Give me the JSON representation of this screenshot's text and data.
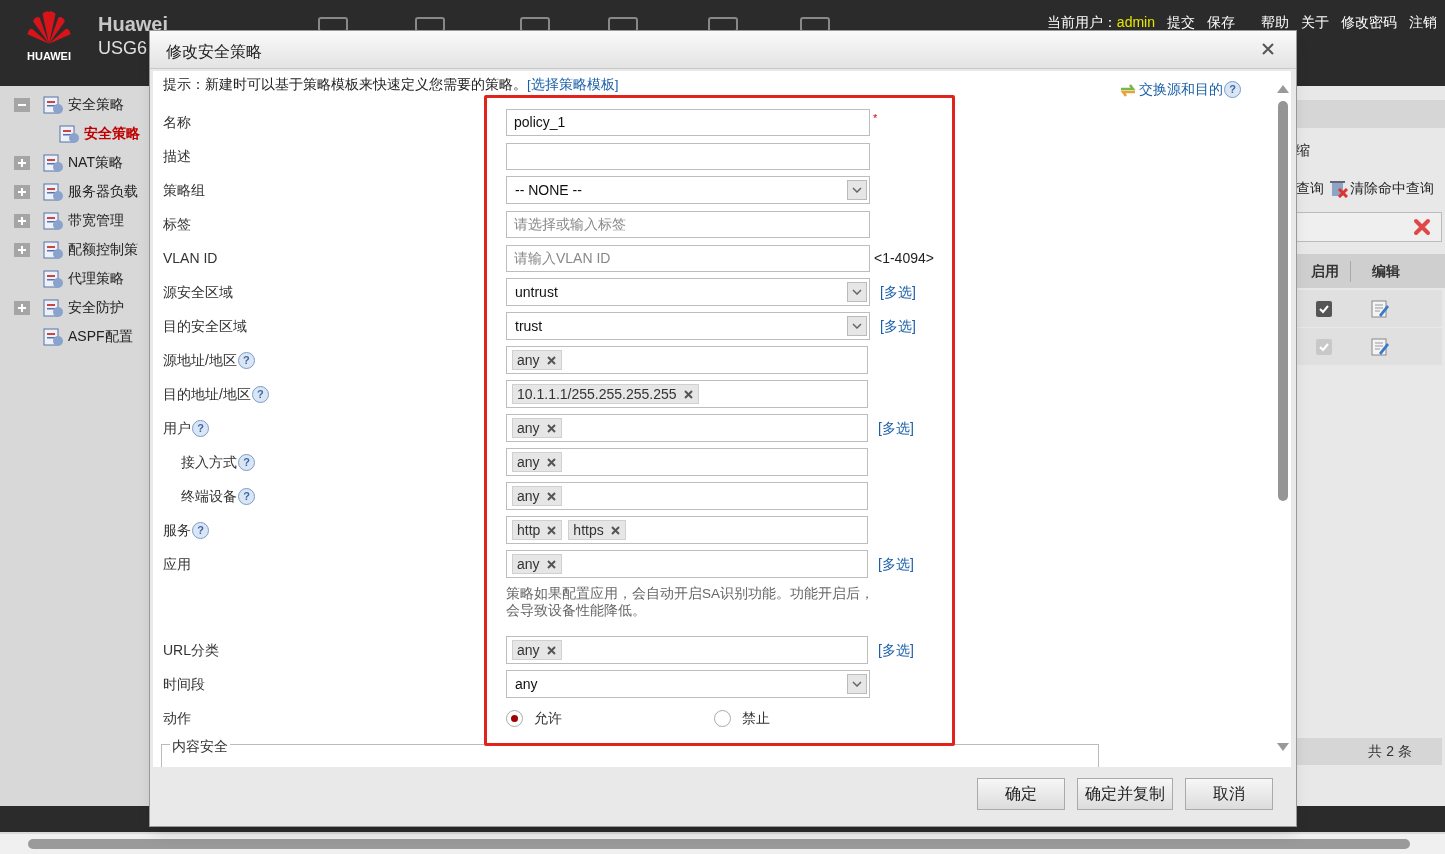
{
  "header": {
    "brand": "HUAWEI",
    "product_line1": "Huawei",
    "product_line2": "USG6",
    "user_label": "当前用户：",
    "user": "admin",
    "links": [
      "提交",
      "保存",
      "帮助",
      "关于",
      "修改密码",
      "注销"
    ]
  },
  "sidebar": {
    "items": [
      {
        "label": "安全策略",
        "expanded": true,
        "selected": false,
        "children": [
          {
            "label": "安全策略",
            "selected": true
          }
        ]
      },
      {
        "label": "NAT策略",
        "expanded": false,
        "selected": false
      },
      {
        "label": "服务器负载",
        "expanded": false,
        "selected": false
      },
      {
        "label": "带宽管理",
        "expanded": false,
        "selected": false
      },
      {
        "label": "配额控制策",
        "expanded": false,
        "selected": false
      },
      {
        "label": "代理策略",
        "selected": false
      },
      {
        "label": "安全防护",
        "expanded": false,
        "selected": false
      },
      {
        "label": "ASPF配置",
        "selected": false
      }
    ]
  },
  "background_panel": {
    "collapse_text": "缩",
    "query_text": "查询",
    "clear_text": "清除命中查询",
    "columns": [
      "启用",
      "编辑"
    ],
    "rows": [
      {
        "enabled": true,
        "disabled": false
      },
      {
        "enabled": true,
        "disabled": true
      }
    ],
    "total": "共 2 条"
  },
  "dialog": {
    "title": "修改安全策略",
    "hint": "提示：新建时可以基于策略模板来快速定义您需要的策略。",
    "template_link": "[选择策略模板]",
    "swap_link": "交换源和目的",
    "swap_help": "?",
    "fields": [
      {
        "kind": "text",
        "label": "名称",
        "value": "policy_1",
        "required_mark": "*"
      },
      {
        "kind": "text",
        "label": "描述"
      },
      {
        "kind": "select",
        "label": "策略组",
        "value": "-- NONE --"
      },
      {
        "kind": "text",
        "label": "标签",
        "placeholder": "请选择或输入标签"
      },
      {
        "kind": "text",
        "label": "VLAN ID",
        "placeholder": "请输入VLAN ID",
        "suffix": "<1-4094>"
      },
      {
        "kind": "select",
        "label": "源安全区域",
        "value": "untrust",
        "link": "[多选]"
      },
      {
        "kind": "select",
        "label": "目的安全区域",
        "value": "trust",
        "link": "[多选]"
      },
      {
        "kind": "tags",
        "label": "源地址/地区",
        "help": "?",
        "tags": [
          "any"
        ]
      },
      {
        "kind": "tags",
        "label": "目的地址/地区",
        "help": "?",
        "tags": [
          "10.1.1.1/255.255.255.255"
        ]
      },
      {
        "kind": "tags",
        "label": "用户",
        "help": "?",
        "tags": [
          "any"
        ],
        "link": "[多选]",
        "children": [
          {
            "kind": "tags",
            "label": "接入方式",
            "help": "?",
            "tags": [
              "any"
            ]
          },
          {
            "kind": "tags",
            "label": "终端设备",
            "help": "?",
            "tags": [
              "any"
            ]
          }
        ]
      },
      {
        "kind": "tags",
        "label": "服务",
        "help": "?",
        "tags": [
          "http",
          "https"
        ]
      },
      {
        "kind": "tags",
        "label": "应用",
        "tags": [
          "any"
        ],
        "link": "[多选]"
      },
      {
        "kind": "note",
        "text": "策略如果配置应用，会自动开启SA识别功能。功能开启后，会导致设备性能降低。"
      },
      {
        "kind": "tags",
        "label": "URL分类",
        "tags": [
          "any"
        ],
        "link": "[多选]"
      },
      {
        "kind": "select",
        "label": "时间段",
        "value": "any"
      },
      {
        "kind": "radio",
        "label": "动作",
        "options": [
          {
            "label": "允许",
            "selected": true
          },
          {
            "label": "禁止",
            "selected": false
          }
        ]
      }
    ],
    "section": "内容安全",
    "buttons": [
      "确定",
      "确定并复制",
      "取消"
    ]
  }
}
